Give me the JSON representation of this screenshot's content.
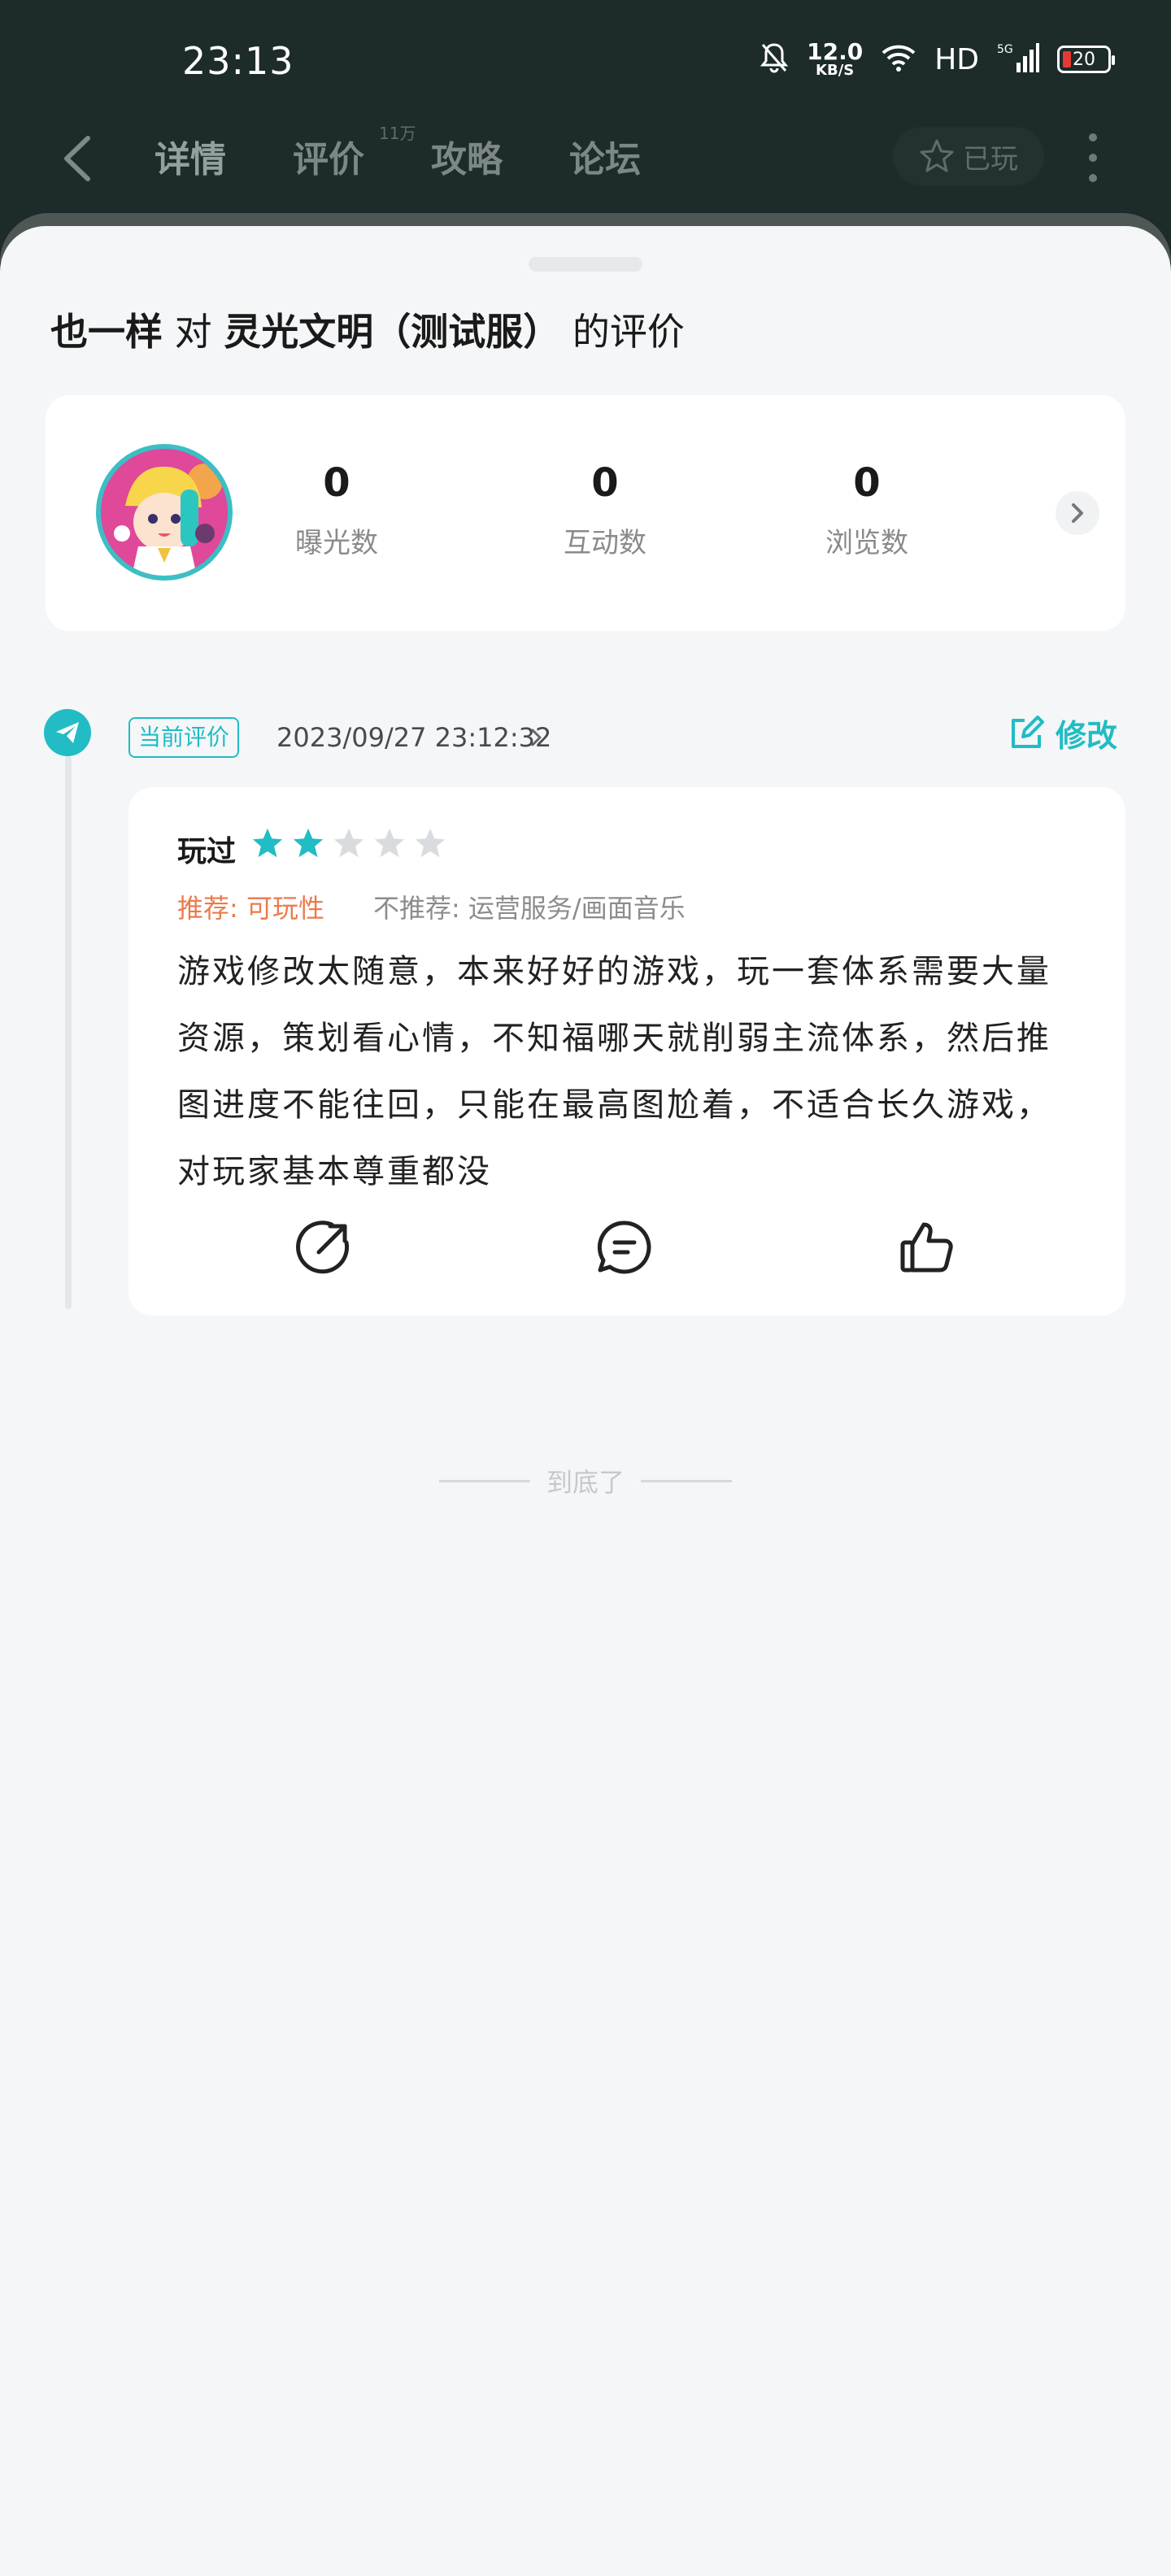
{
  "status_bar": {
    "time": "23:13",
    "net_speed_value": "12.0",
    "net_speed_unit": "KB/S",
    "hd": "HD",
    "battery": "20",
    "icons": [
      "mute-bell-icon",
      "wifi-icon",
      "5g-signal-icon",
      "battery-icon"
    ]
  },
  "header": {
    "tabs": [
      {
        "label": "详情",
        "active": true
      },
      {
        "label": "评价",
        "active": false
      },
      {
        "label": "攻略",
        "active": false
      },
      {
        "label": "论坛",
        "active": false
      }
    ],
    "review_count_badge": "11万",
    "played_button": "已玩"
  },
  "sheet": {
    "title_user": "也一样",
    "title_mid": "对",
    "title_game": "灵光文明（测试服）",
    "title_suffix": "的评价",
    "stats": [
      {
        "value": "0",
        "label": "曝光数"
      },
      {
        "value": "0",
        "label": "互动数"
      },
      {
        "value": "0",
        "label": "浏览数"
      }
    ]
  },
  "review": {
    "badge": "当前评价",
    "date": "2023/09/27 23:12:32",
    "edit_label": "修改",
    "played_label": "玩过",
    "rating": 2,
    "rating_max": 5,
    "recommend": "推荐: 可玩性",
    "not_recommend": "不推荐: 运营服务/画面音乐",
    "text": "游戏修改太随意，本来好好的游戏，玩一套体系需要大量资源，策划看心情，不知福哪天就削弱主流体系，然后推图进度不能往回，只能在最高图尬着，不适合长久游戏，对玩家基本尊重都没"
  },
  "footer": {
    "end_text": "到底了"
  },
  "colors": {
    "accent": "#21bcc4",
    "recommend": "#ea7b4c",
    "header_bg": "#1d2b2a",
    "sheet_bg": "#f4f6f8"
  }
}
